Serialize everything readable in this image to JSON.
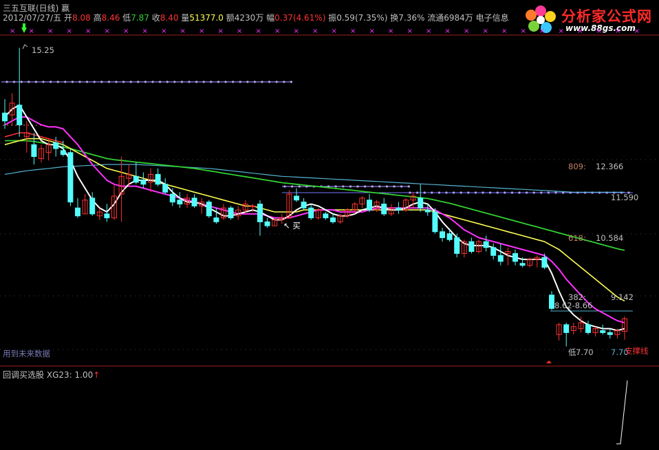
{
  "header": {
    "title": "三五互联(日线) 赢",
    "date_label": "2012/07/27/五",
    "open_label": "开",
    "open_value": "8.08",
    "high_label": "高",
    "high_value": "8.46",
    "low_label": "低",
    "low_value": "7.87",
    "close_label": "收",
    "close_value": "8.40",
    "vol_label": "量",
    "vol_value": "51377.0",
    "amount_label": "额",
    "amount_value": "4230万",
    "change_label": "幅",
    "change_value": "0.37(4.61%)",
    "amp_label": "振",
    "amp_value": "0.59(7.35%)",
    "turnover_label": "换",
    "turnover_value": "7.36%",
    "float_label": "流通",
    "float_value": "6984万",
    "industry": "电子信息"
  },
  "logo": {
    "name": "分析家公式网",
    "url": "www.88gs.com"
  },
  "annotations": {
    "peak": "15.25",
    "fib_809_label": "809:",
    "fib_809_value": "12.366",
    "level_11590": "11.590",
    "fib_618_label": "618:",
    "fib_618_value": "10.584",
    "level_9142": "9.142",
    "fib_382": "382:",
    "range_label": "8.62-8.66",
    "low_label": "7.70",
    "low_prefix": "低",
    "low_value_right": "7.70",
    "buy_label": "买",
    "future_data_note": "用到未来数据",
    "support_line_label": "支撑线"
  },
  "sub_panel": {
    "title": "回调买选股",
    "indicator": "XG23: 1.00",
    "arrow": "↑"
  },
  "colors": {
    "up": "#ff3232",
    "down": "#54fcfc",
    "ma_white": "#ffffff",
    "ma_magenta": "#ff32ff",
    "ma_yellow": "#ffff54",
    "ma_green": "#32d232",
    "ma_cyan": "#54b4d2",
    "ma_red": "#ff3232",
    "dotted": "#b4a0ff",
    "frame": "#a02020"
  },
  "chart_data": {
    "type": "candlestick",
    "y_range": [
      7.5,
      15.5
    ],
    "candles": [
      {
        "o": 13.6,
        "h": 13.95,
        "l": 13.2,
        "c": 13.4
      },
      {
        "o": 13.55,
        "h": 14.1,
        "l": 13.3,
        "c": 13.85
      },
      {
        "o": 13.8,
        "h": 15.25,
        "l": 13.0,
        "c": 13.3
      },
      {
        "o": 13.0,
        "h": 13.4,
        "l": 12.6,
        "c": 13.1
      },
      {
        "o": 12.8,
        "h": 13.1,
        "l": 12.3,
        "c": 12.5
      },
      {
        "o": 12.45,
        "h": 12.8,
        "l": 12.35,
        "c": 12.7
      },
      {
        "o": 12.6,
        "h": 12.95,
        "l": 12.4,
        "c": 12.8
      },
      {
        "o": 12.85,
        "h": 13.0,
        "l": 12.5,
        "c": 12.7
      },
      {
        "o": 12.65,
        "h": 12.9,
        "l": 12.5,
        "c": 12.55
      },
      {
        "o": 12.6,
        "h": 12.7,
        "l": 11.25,
        "c": 11.35
      },
      {
        "o": 11.2,
        "h": 11.45,
        "l": 10.95,
        "c": 11.0
      },
      {
        "o": 11.05,
        "h": 11.55,
        "l": 11.05,
        "c": 11.4
      },
      {
        "o": 11.45,
        "h": 11.6,
        "l": 11.0,
        "c": 11.05
      },
      {
        "o": 11.0,
        "h": 11.2,
        "l": 10.9,
        "c": 11.1
      },
      {
        "o": 11.05,
        "h": 11.3,
        "l": 10.85,
        "c": 10.95
      },
      {
        "o": 10.95,
        "h": 11.8,
        "l": 10.9,
        "c": 11.5
      },
      {
        "o": 11.55,
        "h": 12.5,
        "l": 10.85,
        "c": 12.0
      },
      {
        "o": 11.95,
        "h": 12.3,
        "l": 11.75,
        "c": 12.05
      },
      {
        "o": 12.0,
        "h": 12.35,
        "l": 11.8,
        "c": 11.85
      },
      {
        "o": 11.9,
        "h": 12.1,
        "l": 11.7,
        "c": 11.8
      },
      {
        "o": 11.85,
        "h": 12.2,
        "l": 11.6,
        "c": 12.05
      },
      {
        "o": 12.05,
        "h": 12.2,
        "l": 11.75,
        "c": 11.8
      },
      {
        "o": 11.8,
        "h": 11.95,
        "l": 11.55,
        "c": 11.6
      },
      {
        "o": 11.55,
        "h": 11.7,
        "l": 11.25,
        "c": 11.35
      },
      {
        "o": 11.4,
        "h": 11.6,
        "l": 11.2,
        "c": 11.3
      },
      {
        "o": 11.3,
        "h": 11.55,
        "l": 11.2,
        "c": 11.45
      },
      {
        "o": 11.45,
        "h": 11.55,
        "l": 11.2,
        "c": 11.25
      },
      {
        "o": 11.25,
        "h": 11.45,
        "l": 11.05,
        "c": 11.35
      },
      {
        "o": 11.35,
        "h": 11.4,
        "l": 10.95,
        "c": 11.0
      },
      {
        "o": 10.95,
        "h": 11.2,
        "l": 10.8,
        "c": 10.85
      },
      {
        "o": 10.95,
        "h": 11.3,
        "l": 10.9,
        "c": 11.2
      },
      {
        "o": 11.2,
        "h": 11.25,
        "l": 10.9,
        "c": 10.95
      },
      {
        "o": 11.0,
        "h": 11.25,
        "l": 10.9,
        "c": 11.15
      },
      {
        "o": 11.15,
        "h": 11.4,
        "l": 11.05,
        "c": 11.3
      },
      {
        "o": 11.25,
        "h": 11.3,
        "l": 11.1,
        "c": 11.25
      },
      {
        "o": 11.3,
        "h": 11.4,
        "l": 10.5,
        "c": 10.85
      },
      {
        "o": 10.85,
        "h": 10.95,
        "l": 10.7,
        "c": 10.75
      },
      {
        "o": 10.75,
        "h": 10.95,
        "l": 10.75,
        "c": 10.9
      },
      {
        "o": 10.9,
        "h": 11.05,
        "l": 10.8,
        "c": 10.95
      },
      {
        "o": 10.95,
        "h": 11.65,
        "l": 10.95,
        "c": 11.55
      },
      {
        "o": 11.5,
        "h": 11.7,
        "l": 11.35,
        "c": 11.4
      },
      {
        "o": 11.35,
        "h": 11.45,
        "l": 11.15,
        "c": 11.2
      },
      {
        "o": 11.2,
        "h": 11.3,
        "l": 10.9,
        "c": 10.95
      },
      {
        "o": 10.95,
        "h": 11.2,
        "l": 10.9,
        "c": 11.15
      },
      {
        "o": 11.05,
        "h": 11.1,
        "l": 10.9,
        "c": 10.95
      },
      {
        "o": 10.95,
        "h": 11.05,
        "l": 10.8,
        "c": 10.85
      },
      {
        "o": 10.85,
        "h": 11.05,
        "l": 10.8,
        "c": 11.0
      },
      {
        "o": 11.0,
        "h": 11.2,
        "l": 10.95,
        "c": 11.15
      },
      {
        "o": 11.15,
        "h": 11.35,
        "l": 11.05,
        "c": 11.3
      },
      {
        "o": 11.3,
        "h": 11.5,
        "l": 11.2,
        "c": 11.45
      },
      {
        "o": 11.4,
        "h": 11.55,
        "l": 11.1,
        "c": 11.15
      },
      {
        "o": 11.15,
        "h": 11.4,
        "l": 11.1,
        "c": 11.35
      },
      {
        "o": 11.3,
        "h": 11.45,
        "l": 11.0,
        "c": 11.05
      },
      {
        "o": 11.05,
        "h": 11.3,
        "l": 11.0,
        "c": 11.2
      },
      {
        "o": 11.2,
        "h": 11.35,
        "l": 11.05,
        "c": 11.15
      },
      {
        "o": 11.15,
        "h": 11.45,
        "l": 11.1,
        "c": 11.4
      },
      {
        "o": 11.4,
        "h": 11.6,
        "l": 11.2,
        "c": 11.5
      },
      {
        "o": 11.45,
        "h": 11.8,
        "l": 11.1,
        "c": 11.2
      },
      {
        "o": 11.15,
        "h": 11.3,
        "l": 11.0,
        "c": 11.1
      },
      {
        "o": 11.1,
        "h": 11.2,
        "l": 10.55,
        "c": 10.6
      },
      {
        "o": 10.6,
        "h": 10.7,
        "l": 10.35,
        "c": 10.45
      },
      {
        "o": 10.55,
        "h": 10.65,
        "l": 10.35,
        "c": 10.4
      },
      {
        "o": 10.45,
        "h": 10.55,
        "l": 9.95,
        "c": 10.05
      },
      {
        "o": 10.05,
        "h": 10.4,
        "l": 9.95,
        "c": 10.35
      },
      {
        "o": 10.35,
        "h": 10.45,
        "l": 10.05,
        "c": 10.1
      },
      {
        "o": 10.1,
        "h": 10.4,
        "l": 10.05,
        "c": 10.35
      },
      {
        "o": 10.35,
        "h": 10.5,
        "l": 10.1,
        "c": 10.2
      },
      {
        "o": 10.2,
        "h": 10.3,
        "l": 9.9,
        "c": 10.0
      },
      {
        "o": 10.0,
        "h": 10.3,
        "l": 9.75,
        "c": 9.85
      },
      {
        "o": 10.05,
        "h": 10.2,
        "l": 9.75,
        "c": 10.1
      },
      {
        "o": 10.05,
        "h": 10.15,
        "l": 9.75,
        "c": 9.85
      },
      {
        "o": 9.8,
        "h": 9.95,
        "l": 9.7,
        "c": 9.75
      },
      {
        "o": 9.75,
        "h": 9.95,
        "l": 9.7,
        "c": 9.9
      },
      {
        "o": 9.9,
        "h": 10.0,
        "l": 9.7,
        "c": 9.95
      },
      {
        "o": 9.95,
        "h": 10.05,
        "l": 9.65,
        "c": 9.7
      },
      {
        "o": 9.0,
        "h": 9.1,
        "l": 8.62,
        "c": 8.66
      },
      {
        "o": 8.0,
        "h": 8.3,
        "l": 7.85,
        "c": 8.25
      },
      {
        "o": 8.25,
        "h": 8.3,
        "l": 7.7,
        "c": 8.05
      },
      {
        "o": 8.1,
        "h": 8.3,
        "l": 8.0,
        "c": 8.2
      },
      {
        "o": 8.15,
        "h": 8.45,
        "l": 8.05,
        "c": 8.3
      },
      {
        "o": 8.25,
        "h": 8.35,
        "l": 8.0,
        "c": 8.05
      },
      {
        "o": 8.05,
        "h": 8.2,
        "l": 7.95,
        "c": 8.15
      },
      {
        "o": 8.1,
        "h": 8.25,
        "l": 8.0,
        "c": 8.05
      },
      {
        "o": 8.05,
        "h": 8.15,
        "l": 7.9,
        "c": 8.0
      },
      {
        "o": 8.0,
        "h": 8.15,
        "l": 7.9,
        "c": 8.1
      },
      {
        "o": 8.08,
        "h": 8.46,
        "l": 7.87,
        "c": 8.4
      }
    ],
    "ma_white": [
      13.5,
      13.7,
      13.8,
      13.5,
      13.2,
      12.9,
      12.8,
      12.8,
      12.7,
      12.4,
      12.0,
      11.7,
      11.4,
      11.2,
      11.1,
      11.3,
      11.6,
      11.8,
      11.9,
      11.9,
      11.9,
      11.9,
      11.8,
      11.6,
      11.45,
      11.35,
      11.35,
      11.3,
      11.2,
      11.1,
      11.0,
      11.0,
      11.05,
      11.1,
      11.15,
      11.1,
      11.0,
      10.9,
      10.9,
      11.0,
      11.15,
      11.25,
      11.3,
      11.25,
      11.15,
      11.05,
      11.0,
      11.0,
      11.05,
      11.15,
      11.2,
      11.25,
      11.2,
      11.15,
      11.15,
      11.2,
      11.3,
      11.35,
      11.3,
      11.1,
      10.85,
      10.65,
      10.45,
      10.3,
      10.25,
      10.25,
      10.25,
      10.2,
      10.1,
      10.0,
      9.95,
      9.9,
      9.9,
      9.9,
      9.9,
      9.55,
      9.1,
      8.7,
      8.5,
      8.35,
      8.25,
      8.2,
      8.15,
      8.15,
      8.1,
      8.15
    ],
    "ma_magenta": [
      13.3,
      13.4,
      13.5,
      13.5,
      13.4,
      13.3,
      13.25,
      13.25,
      13.2,
      13.0,
      12.8,
      12.55,
      12.3,
      12.1,
      11.9,
      11.8,
      11.75,
      11.75,
      11.75,
      11.7,
      11.65,
      11.6,
      11.55,
      11.5,
      11.45,
      11.4,
      11.35,
      11.3,
      11.25,
      11.2,
      11.15,
      11.1,
      11.05,
      11.05,
      11.05,
      11.05,
      11.0,
      10.95,
      10.95,
      10.95,
      11.0,
      11.05,
      11.1,
      11.15,
      11.15,
      11.15,
      11.1,
      11.1,
      11.1,
      11.1,
      11.15,
      11.2,
      11.2,
      11.2,
      11.2,
      11.2,
      11.2,
      11.2,
      11.2,
      11.15,
      11.05,
      10.95,
      10.8,
      10.65,
      10.55,
      10.45,
      10.4,
      10.35,
      10.3,
      10.25,
      10.2,
      10.15,
      10.1,
      10.05,
      10.0,
      9.85,
      9.65,
      9.4,
      9.2,
      9.0,
      8.8,
      8.65,
      8.55,
      8.45,
      8.35,
      8.3
    ],
    "ma_yellow": [
      12.8,
      12.85,
      12.9,
      12.95,
      12.95,
      12.95,
      12.9,
      12.85,
      12.8,
      12.7,
      12.6,
      12.5,
      12.4,
      12.3,
      12.2,
      12.15,
      12.1,
      12.05,
      12.0,
      11.95,
      11.9,
      11.85,
      11.8,
      11.75,
      11.7,
      11.65,
      11.6,
      11.55,
      11.5,
      11.45,
      11.4,
      11.35,
      11.3,
      11.25,
      11.25,
      11.2,
      11.15,
      11.1,
      11.1,
      11.1,
      11.1,
      11.15,
      11.15,
      11.15,
      11.15,
      11.15,
      11.15,
      11.15,
      11.15,
      11.15,
      11.15,
      11.15,
      11.15,
      11.15,
      11.15,
      11.15,
      11.15,
      11.15,
      11.15,
      11.1,
      11.05,
      11.0,
      10.95,
      10.9,
      10.85,
      10.8,
      10.75,
      10.7,
      10.65,
      10.6,
      10.55,
      10.5,
      10.45,
      10.4,
      10.35,
      10.25,
      10.15,
      10.0,
      9.85,
      9.7,
      9.55,
      9.4,
      9.25,
      9.1,
      8.95,
      8.85
    ],
    "ma_green": [
      12.9,
      12.9,
      12.9,
      12.9,
      12.88,
      12.85,
      12.82,
      12.78,
      12.74,
      12.7,
      12.65,
      12.6,
      12.55,
      12.5,
      12.45,
      12.42,
      12.4,
      12.38,
      12.36,
      12.34,
      12.32,
      12.3,
      12.28,
      12.26,
      12.24,
      12.22,
      12.2,
      12.17,
      12.14,
      12.11,
      12.08,
      12.05,
      12.02,
      11.99,
      11.96,
      11.93,
      11.9,
      11.87,
      11.84,
      11.82,
      11.8,
      11.78,
      11.76,
      11.74,
      11.72,
      11.7,
      11.68,
      11.66,
      11.64,
      11.62,
      11.6,
      11.58,
      11.56,
      11.54,
      11.52,
      11.5,
      11.48,
      11.46,
      11.44,
      11.4,
      11.36,
      11.32,
      11.27,
      11.22,
      11.17,
      11.12,
      11.07,
      11.02,
      10.97,
      10.92,
      10.87,
      10.82,
      10.77,
      10.72,
      10.67,
      10.62,
      10.57,
      10.52,
      10.47,
      10.42,
      10.37,
      10.32,
      10.27,
      10.22,
      10.17,
      10.13
    ],
    "ma_cyan": [
      12.05,
      12.08,
      12.11,
      12.14,
      12.16,
      12.18,
      12.2,
      12.22,
      12.24,
      12.25,
      12.26,
      12.27,
      12.28,
      12.29,
      12.3,
      12.3,
      12.3,
      12.3,
      12.3,
      12.29,
      12.28,
      12.27,
      12.26,
      12.25,
      12.24,
      12.23,
      12.22,
      12.21,
      12.2,
      12.18,
      12.16,
      12.14,
      12.12,
      12.1,
      12.08,
      12.06,
      12.04,
      12.02,
      12.0,
      11.99,
      11.98,
      11.97,
      11.96,
      11.95,
      11.94,
      11.93,
      11.92,
      11.91,
      11.9,
      11.89,
      11.88,
      11.87,
      11.86,
      11.85,
      11.84,
      11.83,
      11.82,
      11.81,
      11.8,
      11.79,
      11.78,
      11.77,
      11.76,
      11.75,
      11.74,
      11.73,
      11.72,
      11.71,
      11.7,
      11.69,
      11.68,
      11.67,
      11.66,
      11.65,
      11.64,
      11.63,
      11.62,
      11.61,
      11.6,
      11.6,
      11.6,
      11.6,
      11.6,
      11.6,
      11.6,
      11.6
    ],
    "ma_red": [
      13.0,
      13.05,
      13.1,
      13.1,
      13.05,
      13.0,
      12.95,
      12.9,
      12.85
    ]
  }
}
